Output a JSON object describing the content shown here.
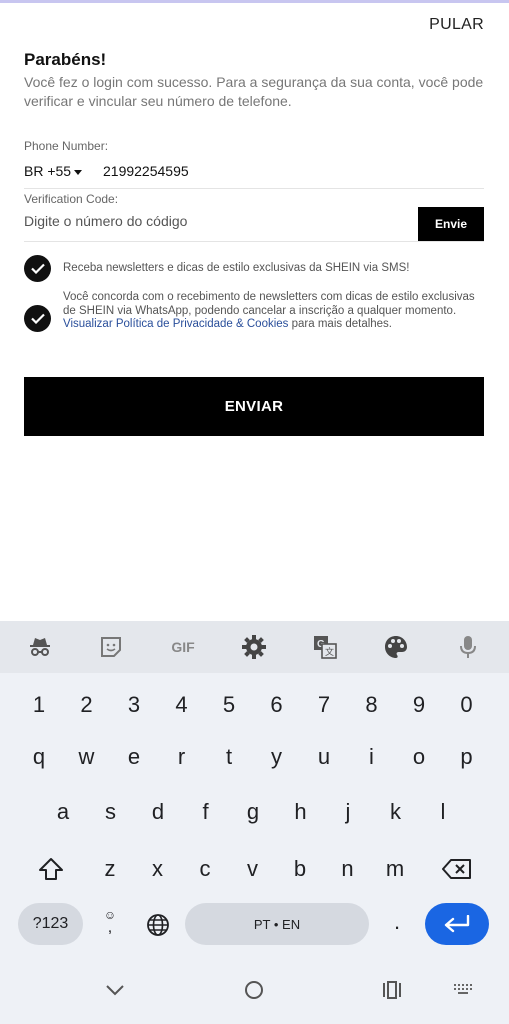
{
  "header": {
    "skip_label": "PULAR"
  },
  "main": {
    "title": "Parabéns!",
    "subtitle": "Você fez o login com sucesso. Para a segurança da sua conta, você pode verificar e vincular seu número de telefone.",
    "phone_label": "Phone Number:",
    "country_code": "BR +55",
    "phone_value": "21992254595",
    "code_label": "Verification Code:",
    "code_placeholder": "Digite o número do código",
    "send_code_label": "Envie",
    "sms_consent": "Receba newsletters e dicas de estilo exclusivas da SHEIN via SMS!",
    "whatsapp_consent_prefix": "Você concorda com o recebimento de newsletters com dicas de estilo exclusivas de SHEIN via WhatsApp, podendo cancelar a inscrição a qualquer momento.",
    "privacy_link": "Visualizar Política de Privacidade & Cookies",
    "whatsapp_consent_suffix": "para mais detalhes.",
    "submit_label": "ENVIAR"
  },
  "keyboard": {
    "toolbar": [
      "incognito-icon",
      "sticker-icon",
      "gif-icon",
      "settings-icon",
      "translate-icon",
      "theme-palette-icon",
      "microphone-icon"
    ],
    "gif_label": "GIF",
    "row_numbers": [
      "1",
      "2",
      "3",
      "4",
      "5",
      "6",
      "7",
      "8",
      "9",
      "0"
    ],
    "row1": [
      "q",
      "w",
      "e",
      "r",
      "t",
      "y",
      "u",
      "i",
      "o",
      "p"
    ],
    "row2": [
      "a",
      "s",
      "d",
      "f",
      "g",
      "h",
      "j",
      "k",
      "l"
    ],
    "row3": [
      "z",
      "x",
      "c",
      "v",
      "b",
      "n",
      "m"
    ],
    "symbols_label": "?123",
    "space_label": "PT • EN",
    "period_label": ".",
    "comma_label": ","
  },
  "navbar": [
    "back-chevron-icon",
    "home-circle-icon",
    "recents-icon",
    "keyboard-switch-icon"
  ]
}
